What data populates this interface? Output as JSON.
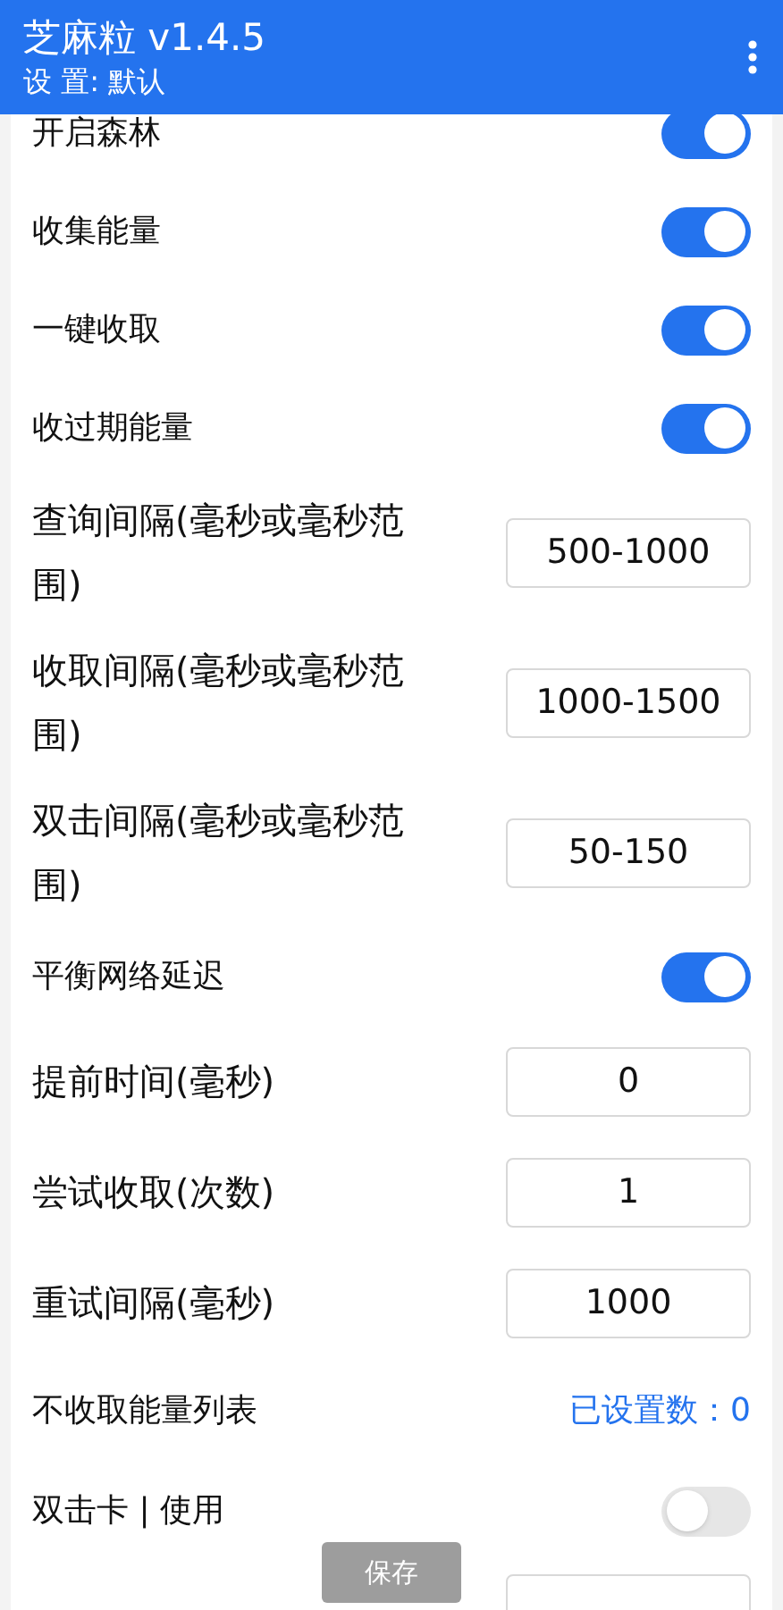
{
  "app_bar": {
    "title": "芝麻粒 v1.4.5",
    "subtitle": "设 置: 默认"
  },
  "settings": [
    {
      "kind": "toggle",
      "label": "开启森林",
      "on": true
    },
    {
      "kind": "toggle",
      "label": "收集能量",
      "on": true
    },
    {
      "kind": "toggle",
      "label": "一键收取",
      "on": true
    },
    {
      "kind": "toggle",
      "label": "收过期能量",
      "on": true
    },
    {
      "kind": "input",
      "label": "查询间隔(毫秒或毫秒范围)",
      "value": "500-1000"
    },
    {
      "kind": "input",
      "label": "收取间隔(毫秒或毫秒范围)",
      "value": "1000-1500"
    },
    {
      "kind": "input",
      "label": "双击间隔(毫秒或毫秒范围)",
      "value": "50-150"
    },
    {
      "kind": "toggle",
      "label": "平衡网络延迟",
      "on": true
    },
    {
      "kind": "input",
      "label": "提前时间(毫秒)",
      "value": "0"
    },
    {
      "kind": "input",
      "label": "尝试收取(次数)",
      "value": "1"
    },
    {
      "kind": "input",
      "label": "重试间隔(毫秒)",
      "value": "1000"
    },
    {
      "kind": "link",
      "label": "不收取能量列表",
      "value": "已设置数：0"
    },
    {
      "kind": "toggle",
      "label": "双击卡 | 使用",
      "on": false
    },
    {
      "kind": "cut"
    }
  ],
  "save_button": {
    "label": "保存",
    "disabled": true
  }
}
